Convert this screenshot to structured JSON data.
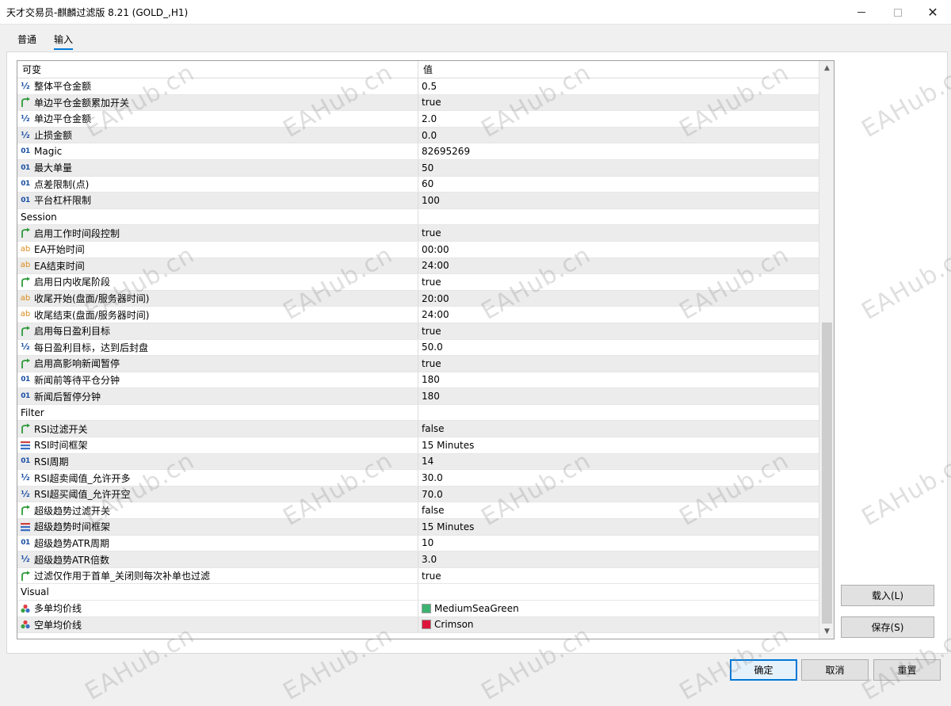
{
  "window": {
    "title": "天才交易员-麒麟过滤版 8.21 (GOLD_,H1)",
    "minimize_glyph": "",
    "close_glyph": "✕"
  },
  "tabs": [
    {
      "label": "普通"
    },
    {
      "label": "输入",
      "selected": true
    }
  ],
  "grid": {
    "headers": {
      "variable": "可变",
      "value": "值"
    },
    "rows": [
      {
        "type": "double",
        "icon": "half-icon",
        "name": "整体平仓金额",
        "value": "0.5"
      },
      {
        "type": "bool",
        "icon": "bool-arrow-icon",
        "name": "单边平仓金额累加开关",
        "value": "true"
      },
      {
        "type": "double",
        "icon": "half-icon",
        "name": "单边平仓金额",
        "value": "2.0"
      },
      {
        "type": "double",
        "icon": "half-icon",
        "name": "止损金额",
        "value": "0.0"
      },
      {
        "type": "int",
        "icon": "int-01-icon",
        "name": "Magic",
        "value": "82695269"
      },
      {
        "type": "int",
        "icon": "int-01-icon",
        "name": "最大单量",
        "value": "50"
      },
      {
        "type": "int",
        "icon": "int-01-icon",
        "name": "点差限制(点)",
        "value": "60"
      },
      {
        "type": "int",
        "icon": "int-01-icon",
        "name": "平台杠杆限制",
        "value": "100"
      },
      {
        "type": "group",
        "icon": "",
        "name": "Session",
        "value": ""
      },
      {
        "type": "bool",
        "icon": "bool-arrow-icon",
        "name": "启用工作时间段控制",
        "value": "true"
      },
      {
        "type": "string",
        "icon": "string-ab-icon",
        "name": "EA开始时间",
        "value": "00:00"
      },
      {
        "type": "string",
        "icon": "string-ab-icon",
        "name": "EA结束时间",
        "value": "24:00"
      },
      {
        "type": "bool",
        "icon": "bool-arrow-icon",
        "name": "启用日内收尾阶段",
        "value": "true"
      },
      {
        "type": "string",
        "icon": "string-ab-icon",
        "name": "收尾开始(盘面/服务器时间)",
        "value": "20:00"
      },
      {
        "type": "string",
        "icon": "string-ab-icon",
        "name": "收尾结束(盘面/服务器时间)",
        "value": "24:00"
      },
      {
        "type": "bool",
        "icon": "bool-arrow-icon",
        "name": "启用每日盈利目标",
        "value": "true"
      },
      {
        "type": "double",
        "icon": "half-icon",
        "name": "每日盈利目标，达到后封盘",
        "value": "50.0"
      },
      {
        "type": "bool",
        "icon": "bool-arrow-icon",
        "name": "启用高影响新闻暂停",
        "value": "true"
      },
      {
        "type": "int",
        "icon": "int-01-icon",
        "name": "新闻前等待平仓分钟",
        "value": "180"
      },
      {
        "type": "int",
        "icon": "int-01-icon",
        "name": "新闻后暂停分钟",
        "value": "180"
      },
      {
        "type": "group",
        "icon": "",
        "name": "Filter",
        "value": ""
      },
      {
        "type": "bool",
        "icon": "bool-arrow-icon",
        "name": "RSI过滤开关",
        "value": "false"
      },
      {
        "type": "enum",
        "icon": "enum-list-icon",
        "name": "RSI时间框架",
        "value": "15 Minutes"
      },
      {
        "type": "int",
        "icon": "int-01-icon",
        "name": "RSI周期",
        "value": "14"
      },
      {
        "type": "double",
        "icon": "half-icon",
        "name": "RSI超卖阈值_允许开多",
        "value": "30.0"
      },
      {
        "type": "double",
        "icon": "half-icon",
        "name": "RSI超买阈值_允许开空",
        "value": "70.0"
      },
      {
        "type": "bool",
        "icon": "bool-arrow-icon",
        "name": "超级趋势过滤开关",
        "value": "false"
      },
      {
        "type": "enum",
        "icon": "enum-list-icon",
        "name": "超级趋势时间框架",
        "value": "15 Minutes"
      },
      {
        "type": "int",
        "icon": "int-01-icon",
        "name": "超级趋势ATR周期",
        "value": "10"
      },
      {
        "type": "double",
        "icon": "half-icon",
        "name": "超级趋势ATR倍数",
        "value": "3.0"
      },
      {
        "type": "bool",
        "icon": "bool-arrow-icon",
        "name": "过滤仅作用于首单_关闭则每次补单也过滤",
        "value": "true"
      },
      {
        "type": "group",
        "icon": "",
        "name": "Visual",
        "value": ""
      },
      {
        "type": "color",
        "icon": "color-palette-icon",
        "name": "多单均价线",
        "value": "MediumSeaGreen",
        "swatch": "#3cb371"
      },
      {
        "type": "color",
        "icon": "color-palette-icon",
        "name": "空单均价线",
        "value": "Crimson",
        "swatch": "#dc143c"
      }
    ]
  },
  "icon_text": {
    "half": "½",
    "int": "01",
    "string": "ab"
  },
  "scrollbar": {
    "up_glyph": "▲",
    "down_glyph": "▼"
  },
  "buttons": {
    "load": "载入(L)",
    "save": "保存(S)",
    "ok": "确定",
    "cancel": "取消",
    "reset": "重置"
  },
  "watermark": "EAHub.cn",
  "colors": {
    "accent": "#0078d7",
    "icon_blue": "#1a4fa3",
    "icon_orange": "#d98a1a",
    "bool_green": "#2e9a3a"
  }
}
